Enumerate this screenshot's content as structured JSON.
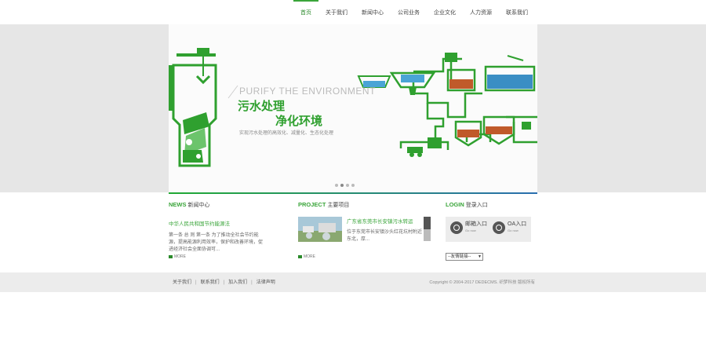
{
  "nav": {
    "items": [
      {
        "label": "首页",
        "active": true
      },
      {
        "label": "关于我们"
      },
      {
        "label": "新闻中心"
      },
      {
        "label": "公司业务"
      },
      {
        "label": "企业文化"
      },
      {
        "label": "人力资源"
      },
      {
        "label": "联系我们"
      }
    ]
  },
  "banner": {
    "slogan_en": "PURIFY THE ENVIRONMENT",
    "slogan_line1": "污水处理",
    "slogan_line2": "净化环境",
    "slogan_sub": "实现污水处理的高效化、减量化、生态化处理",
    "slide_count": 4,
    "active_slide": 1
  },
  "news": {
    "head_en": "NEWS",
    "head_cn": "新闻中心",
    "title": "中华人民共和国节约能源法",
    "text": "第一条 总 则 第一条 为了推动全社会节约能源，提高能源利用效率，保护和改善环境，促进经济社会全面协调可...",
    "more": "MORE"
  },
  "project": {
    "head_en": "PROJECT",
    "head_cn": "主要项目",
    "title": "广东省东莞市长安镇污水转运",
    "text": "位于东莞市长安镇沙头红花坑村附近东北，厚...",
    "more": "MORE"
  },
  "login": {
    "head_en": "LOGIN",
    "head_cn": "登录入口",
    "mail_label": "邮箱入口",
    "mail_sub": "Go now",
    "oa_label": "OA入口",
    "oa_sub": "Go now",
    "select_value": "--友情链接--"
  },
  "footer": {
    "links": [
      "关于我们",
      "联系我们",
      "加入我们",
      "法律声明"
    ],
    "copyright": "Copyright © 2004-2017 DEDECMS. 织梦科技 版权所有"
  },
  "colors": {
    "accent_green": "#3aa53a",
    "banner_gray": "#e6e6e6",
    "footer_gray": "#ececec"
  }
}
